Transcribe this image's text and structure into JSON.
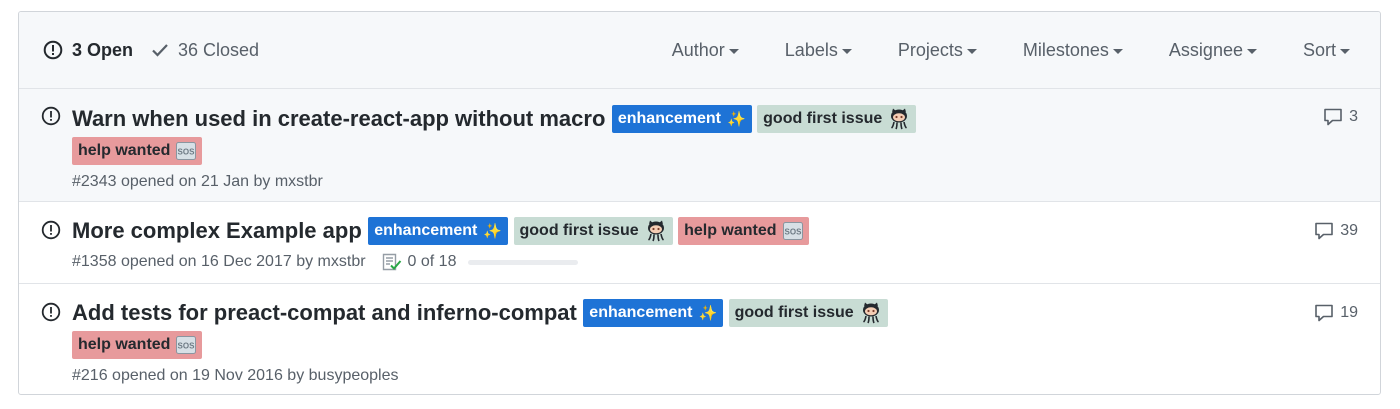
{
  "header": {
    "open_label": "3 Open",
    "closed_label": "36 Closed",
    "filters": [
      "Author",
      "Labels",
      "Projects",
      "Milestones",
      "Assignee",
      "Sort"
    ]
  },
  "labels": {
    "enhancement": "enhancement",
    "good_first_issue": "good first issue",
    "help_wanted": "help wanted"
  },
  "label_emojis": {
    "enhancement": "✨",
    "good_first_issue": "octocat",
    "help_wanted": "sos"
  },
  "issues": [
    {
      "title": "Warn when used in create-react-app without macro",
      "meta": "#2343 opened on 21 Jan by mxstbr",
      "comments": "3"
    },
    {
      "title": "More complex Example app",
      "meta": "#1358 opened on 16 Dec 2017 by mxstbr",
      "tasks": "0 of 18",
      "tasks_progress": 0,
      "comments": "39"
    },
    {
      "title": "Add tests for preact-compat and inferno-compat",
      "meta": "#216 opened on 19 Nov 2016 by busypeoples",
      "comments": "19"
    }
  ],
  "colors": {
    "enhancement": "#1e73d6",
    "good_first_issue": "#c8dcd4",
    "help_wanted": "#e79a9c",
    "header_bg": "#f6f8fa"
  }
}
